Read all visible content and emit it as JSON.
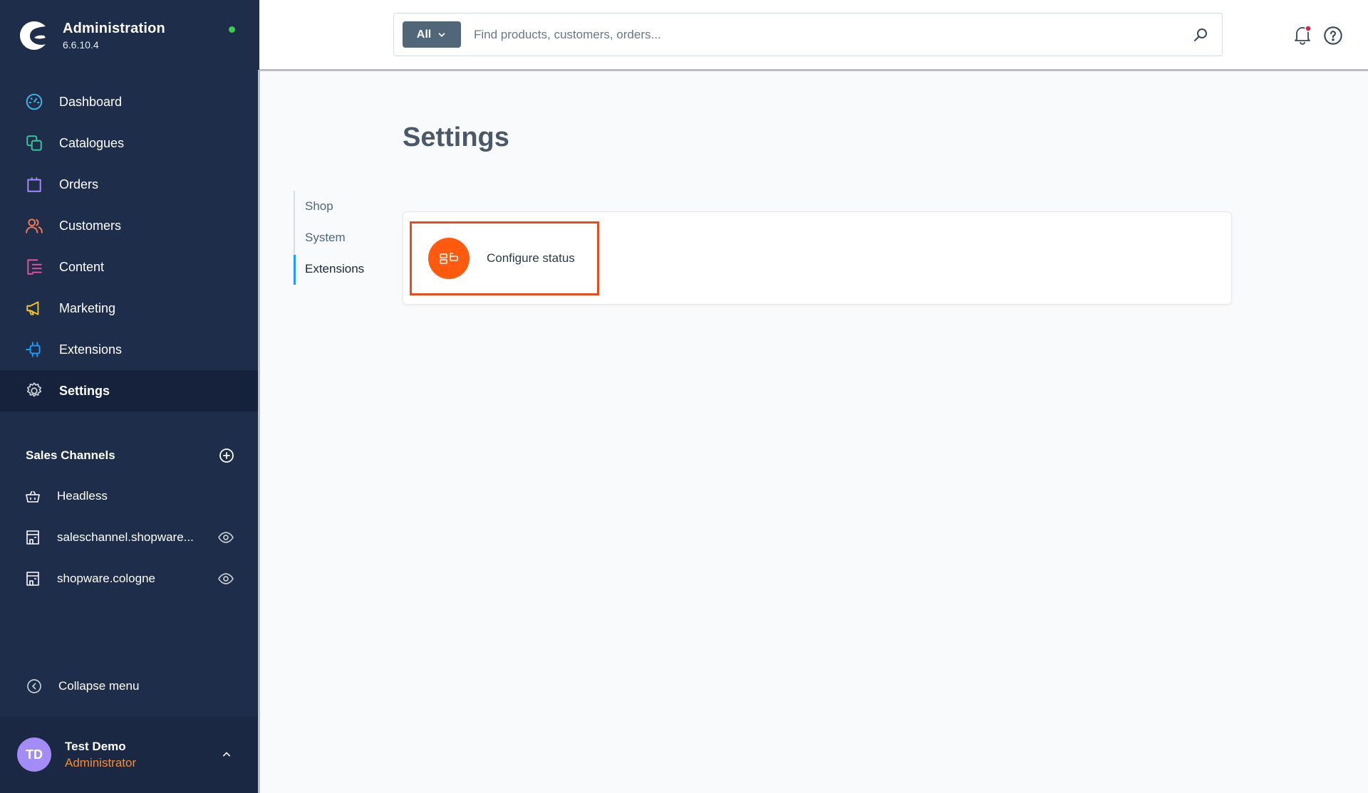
{
  "app": {
    "title": "Administration",
    "version": "6.6.10.4"
  },
  "colors": {
    "sidebar": "#1e2d4a",
    "accent": "#189eff",
    "highlight": "#f04a1a",
    "status_online": "#37d046"
  },
  "nav": [
    {
      "label": "Dashboard",
      "icon": "dashboard-icon"
    },
    {
      "label": "Catalogues",
      "icon": "catalogues-icon"
    },
    {
      "label": "Orders",
      "icon": "orders-icon"
    },
    {
      "label": "Customers",
      "icon": "customers-icon"
    },
    {
      "label": "Content",
      "icon": "content-icon"
    },
    {
      "label": "Marketing",
      "icon": "marketing-icon"
    },
    {
      "label": "Extensions",
      "icon": "extensions-icon"
    },
    {
      "label": "Settings",
      "icon": "gear-icon",
      "active": true
    }
  ],
  "sales_channels": {
    "title": "Sales Channels",
    "items": [
      {
        "label": "Headless",
        "icon": "basket-icon"
      },
      {
        "label": "saleschannel.shopware...",
        "icon": "storefront-icon"
      },
      {
        "label": "shopware.cologne",
        "icon": "storefront-icon"
      }
    ]
  },
  "collapse_label": "Collapse menu",
  "user": {
    "initials": "TD",
    "name": "Test Demo",
    "role": "Administrator"
  },
  "search": {
    "type_label": "All",
    "placeholder": "Find products, customers, orders..."
  },
  "page": {
    "title": "Settings",
    "tabs": [
      {
        "label": "Shop"
      },
      {
        "label": "System"
      },
      {
        "label": "Extensions",
        "active": true
      }
    ],
    "items": [
      {
        "label": "Configure status",
        "icon": "status-flow-icon"
      }
    ]
  }
}
